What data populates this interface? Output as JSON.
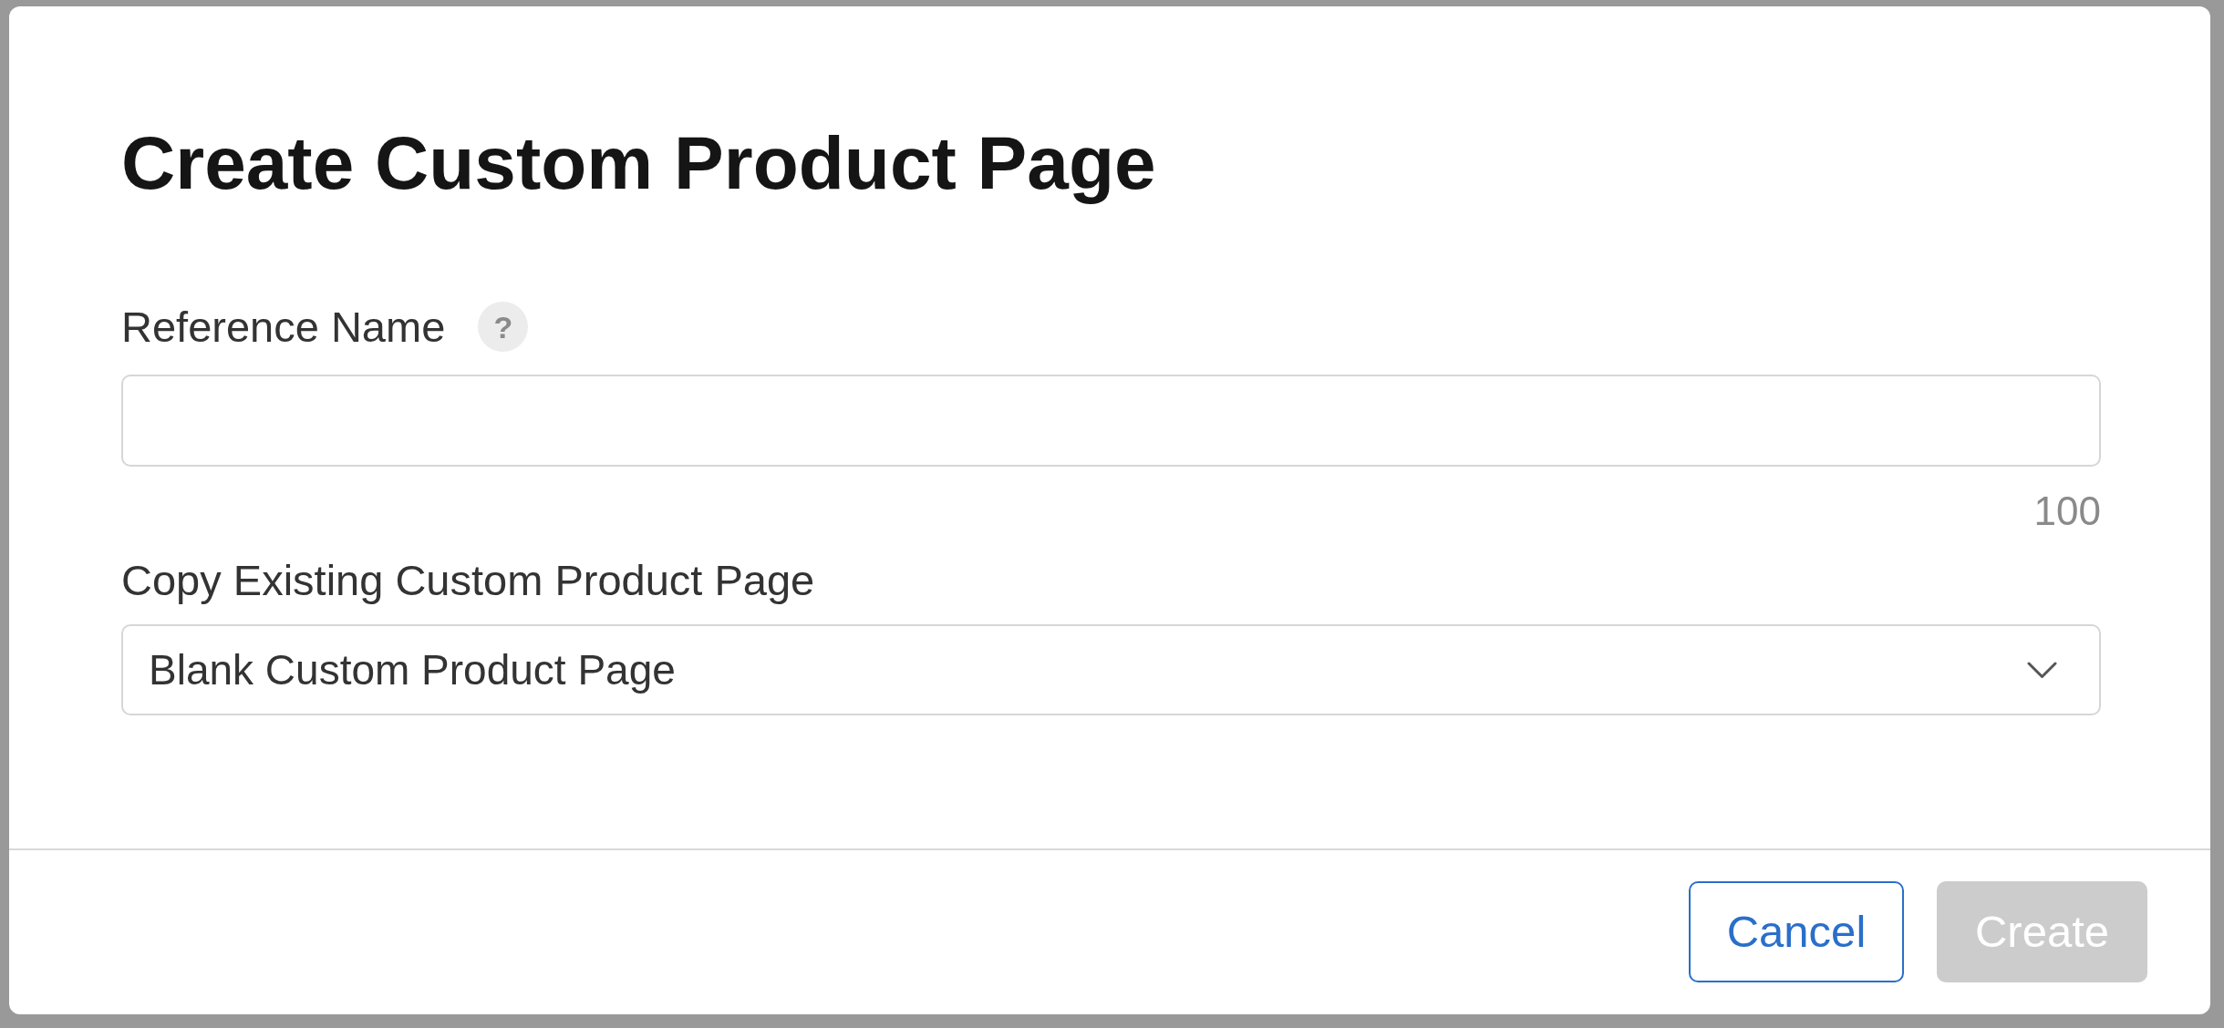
{
  "dialog": {
    "title": "Create Custom Product Page"
  },
  "fields": [
    {
      "kind": "text",
      "label": "Reference Name",
      "help": "?",
      "counter": "100"
    },
    {
      "kind": "select",
      "label": "Copy Existing Custom Product Page",
      "value": "Blank Custom Product Page"
    }
  ],
  "buttons": [
    {
      "label": "Cancel",
      "kind": "secondary",
      "disabled": false
    },
    {
      "label": "Create",
      "kind": "primary",
      "disabled": true
    }
  ]
}
